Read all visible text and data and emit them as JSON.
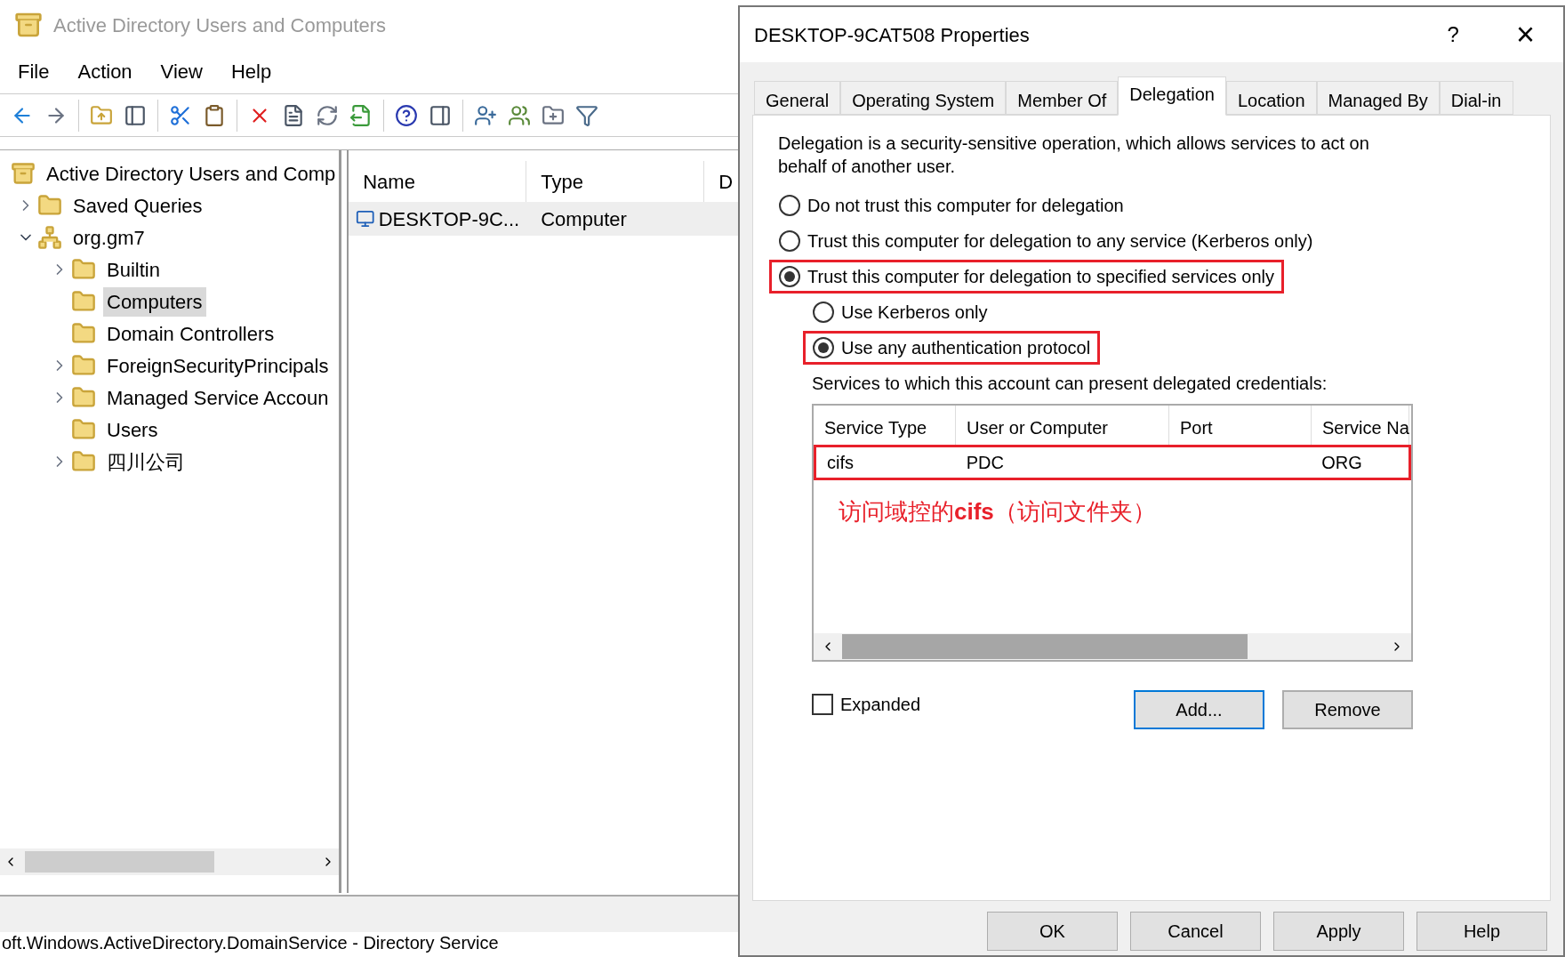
{
  "main_window": {
    "title": "Active Directory Users and Computers",
    "menu": [
      "File",
      "Action",
      "View",
      "Help"
    ],
    "tree": [
      {
        "label": "Active Directory Users and Comp",
        "selected": false,
        "children": [
          {
            "label": "Saved Queries",
            "selected": false,
            "expanded": false
          },
          {
            "label": "org.gm7",
            "selected": false,
            "expanded": true,
            "children": [
              {
                "label": "Builtin",
                "selected": false,
                "expanded": false
              },
              {
                "label": "Computers",
                "selected": true
              },
              {
                "label": "Domain Controllers",
                "selected": false
              },
              {
                "label": "ForeignSecurityPrincipals",
                "selected": false,
                "expanded": false
              },
              {
                "label": "Managed Service Accoun",
                "selected": false,
                "expanded": false
              },
              {
                "label": "Users",
                "selected": false
              },
              {
                "label": "四川公司",
                "selected": false,
                "expanded": false
              }
            ]
          }
        ]
      }
    ],
    "list": {
      "columns": [
        "Name",
        "Type",
        "D"
      ],
      "rows": [
        {
          "cells": [
            "DESKTOP-9C...",
            "Computer"
          ],
          "selected": true
        }
      ]
    },
    "status_bar": "oft.Windows.ActiveDirectory.DomainService - Directory Service"
  },
  "dialog": {
    "title": "DESKTOP-9CAT508 Properties",
    "help": "?",
    "close": "×",
    "tabs": [
      {
        "label": "General",
        "selected": false
      },
      {
        "label": "Operating System",
        "selected": false
      },
      {
        "label": "Member Of",
        "selected": false
      },
      {
        "label": "Delegation",
        "selected": true
      },
      {
        "label": "Location",
        "selected": false
      },
      {
        "label": "Managed By",
        "selected": false
      },
      {
        "label": "Dial-in",
        "selected": false
      }
    ],
    "description": "Delegation is a security-sensitive operation, which allows services to act on behalf of another user.",
    "options": [
      {
        "label": "Do not trust this computer for delegation",
        "selected": false,
        "annotated": false
      },
      {
        "label": "Trust this computer for delegation to any service (Kerberos only)",
        "selected": false,
        "annotated": false
      },
      {
        "label": "Trust this computer for delegation to specified services only",
        "selected": true,
        "annotated": true
      }
    ],
    "sub_options": [
      {
        "label": "Use Kerberos only",
        "selected": false,
        "annotated": false
      },
      {
        "label": "Use any authentication protocol",
        "selected": true,
        "annotated": true
      }
    ],
    "services_label": "Services to which this account can present delegated credentials:",
    "services_table": {
      "columns": [
        "Service Type",
        "User or Computer",
        "Port",
        "Service Na"
      ],
      "rows": [
        {
          "cells": [
            "cifs",
            "PDC",
            "",
            "ORG"
          ],
          "annotated": true
        }
      ]
    },
    "annotation": "访问域控的**cifs**（访问文件夹）",
    "expanded": {
      "label": "Expanded",
      "checked": false
    },
    "buttons": [
      "Add...",
      "Remove"
    ],
    "footer_buttons": [
      "OK",
      "Cancel",
      "Apply",
      "Help"
    ]
  }
}
